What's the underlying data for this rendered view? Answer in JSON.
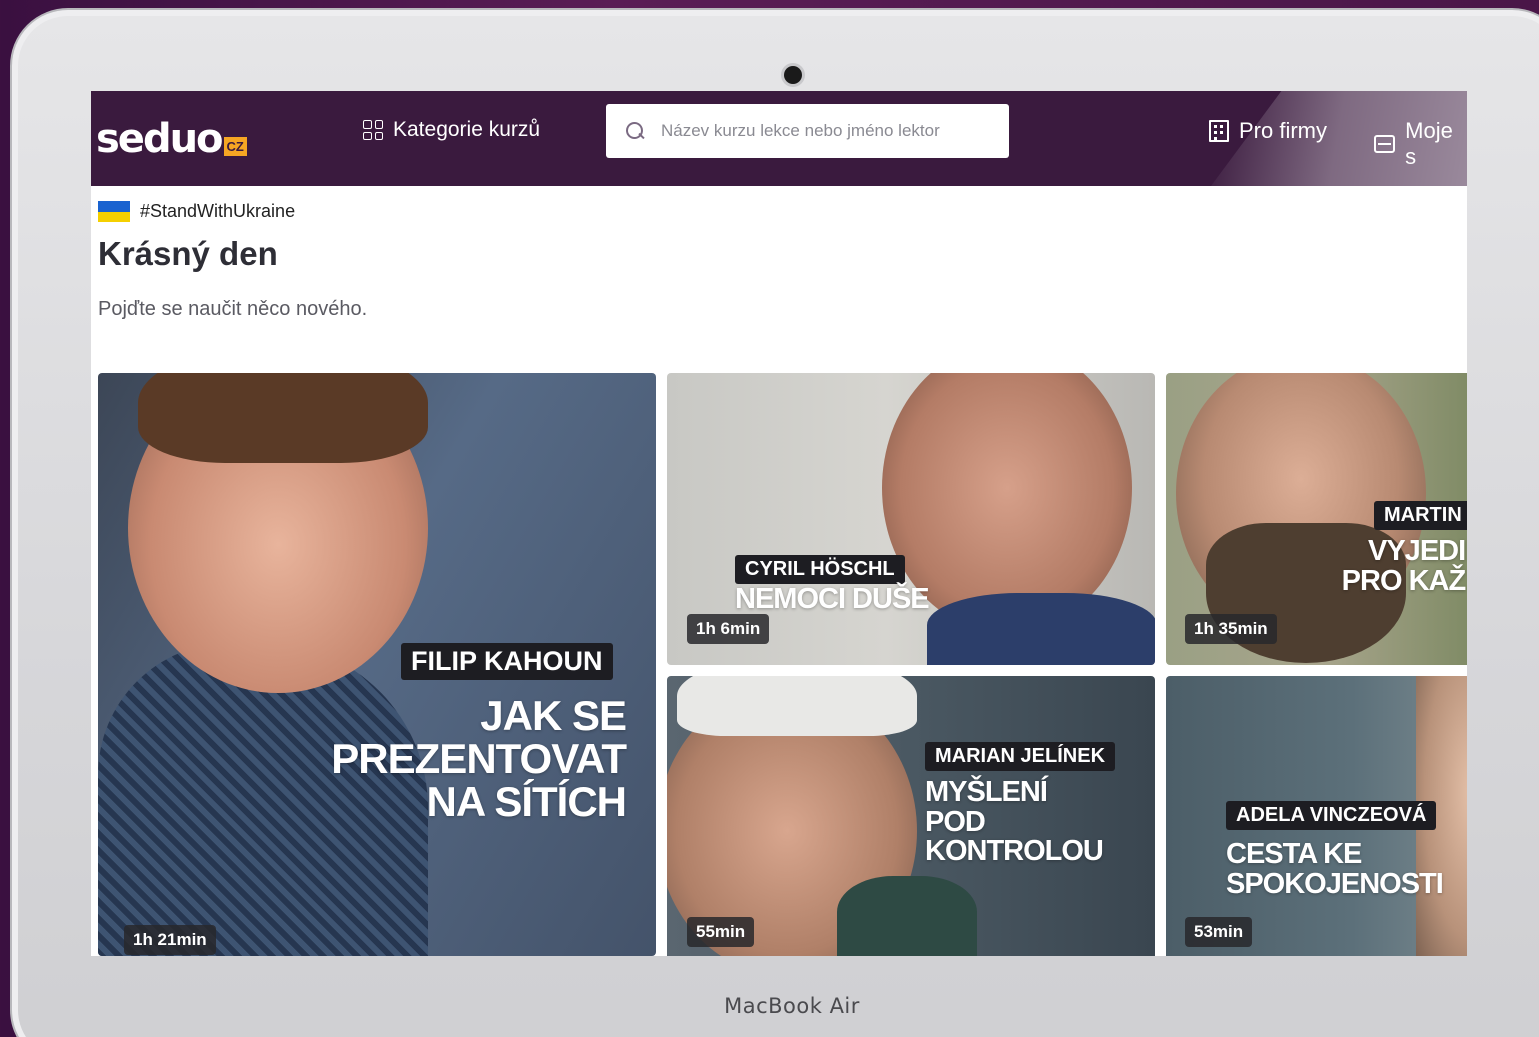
{
  "device": {
    "label": "MacBook Air"
  },
  "header": {
    "logo_text": "seduo",
    "logo_badge": "CZ",
    "categories_label": "Kategorie kurzů",
    "search_placeholder": "Název kurzu lekce nebo jméno lektor",
    "business_label": "Pro firmy",
    "my_label": "Moje s"
  },
  "banner": {
    "hashtag": "#StandWithUkraine"
  },
  "main": {
    "greeting": "Krásný den",
    "subtitle": "Pojďte se naučit něco nového."
  },
  "courses": [
    {
      "lector": "FILIP KAHOUN",
      "title_lines": [
        "JAK SE",
        "PREZENTOVAT",
        "NA SÍTÍCH"
      ],
      "duration": "1h 21min"
    },
    {
      "lector": "CYRIL HÖSCHL",
      "title_lines": [
        "NEMOCI DUŠE"
      ],
      "duration": "1h 6min"
    },
    {
      "lector": "MARTIN",
      "title_lines": [
        "VYJEDI",
        "PRO KAŽ"
      ],
      "duration": "1h 35min"
    },
    {
      "lector": "MARIAN JELÍNEK",
      "title_lines": [
        "MYŠLENÍ",
        "POD",
        "KONTROLOU"
      ],
      "duration": "55min"
    },
    {
      "lector": "ADELA VINCZEOVÁ",
      "title_lines": [
        "CESTA KE",
        "SPOKOJENOSTI"
      ],
      "duration": "53min"
    }
  ],
  "colors": {
    "header_bg": "#3a1a3e",
    "logo_badge": "#f6a623",
    "tag_bg": "#1d1d22"
  }
}
